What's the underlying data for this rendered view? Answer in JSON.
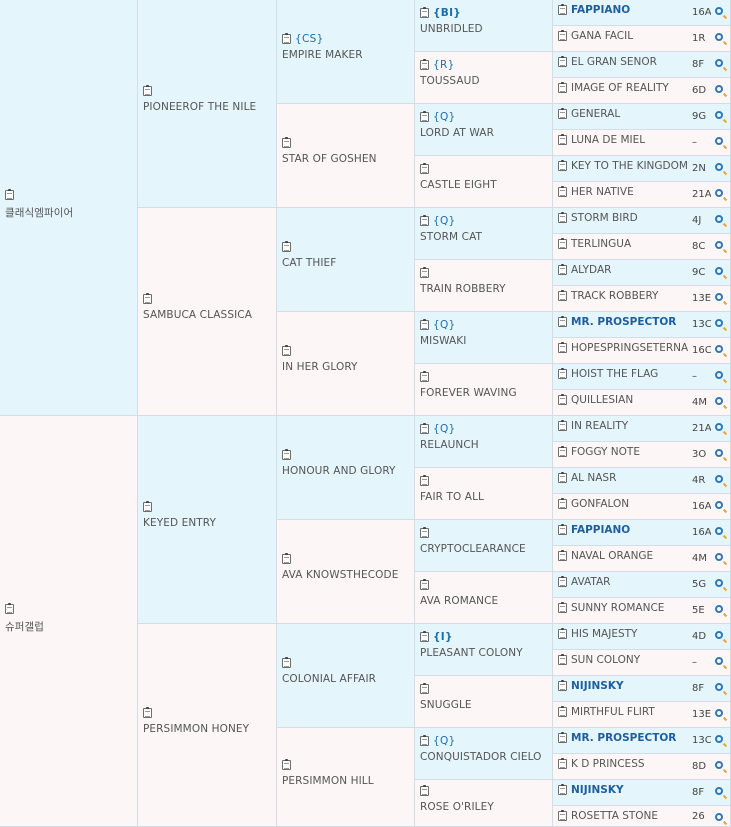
{
  "pedigree": {
    "gen1": [
      {
        "name": "클래식엠파이어",
        "sex": "m"
      },
      {
        "name": "슈퍼갤럽",
        "sex": "f"
      }
    ],
    "gen2": [
      {
        "name": "PIONEEROF THE NILE",
        "sex": "m"
      },
      {
        "name": "SAMBUCA CLASSICA",
        "sex": "f"
      },
      {
        "name": "KEYED ENTRY",
        "sex": "m"
      },
      {
        "name": "PERSIMMON HONEY",
        "sex": "f"
      }
    ],
    "gen3": [
      {
        "name": "EMPIRE MAKER",
        "sex": "m",
        "dosage": "{CS}"
      },
      {
        "name": "STAR OF GOSHEN",
        "sex": "f"
      },
      {
        "name": "CAT THIEF",
        "sex": "m"
      },
      {
        "name": "IN HER GLORY",
        "sex": "f"
      },
      {
        "name": "HONOUR AND GLORY",
        "sex": "m"
      },
      {
        "name": "AVA KNOWSTHECODE",
        "sex": "f"
      },
      {
        "name": "COLONIAL AFFAIR",
        "sex": "m"
      },
      {
        "name": "PERSIMMON HILL",
        "sex": "f"
      }
    ],
    "gen4": [
      {
        "name": "UNBRIDLED",
        "sex": "m",
        "dosage": "{BI}",
        "dosage_bold": true
      },
      {
        "name": "TOUSSAUD",
        "sex": "f",
        "dosage": "{R}"
      },
      {
        "name": "LORD AT WAR",
        "sex": "m",
        "dosage": "{Q}"
      },
      {
        "name": "CASTLE EIGHT",
        "sex": "f"
      },
      {
        "name": "STORM CAT",
        "sex": "m",
        "dosage": "{Q}"
      },
      {
        "name": "TRAIN ROBBERY",
        "sex": "f"
      },
      {
        "name": "MISWAKI",
        "sex": "m",
        "dosage": "{Q}"
      },
      {
        "name": "FOREVER WAVING",
        "sex": "f"
      },
      {
        "name": "RELAUNCH",
        "sex": "m",
        "dosage": "{Q}"
      },
      {
        "name": "FAIR TO ALL",
        "sex": "f"
      },
      {
        "name": "CRYPTOCLEARANCE",
        "sex": "m"
      },
      {
        "name": "AVA ROMANCE",
        "sex": "f"
      },
      {
        "name": "PLEASANT COLONY",
        "sex": "m",
        "dosage": "{I}",
        "dosage_bold": true
      },
      {
        "name": "SNUGGLE",
        "sex": "f"
      },
      {
        "name": "CONQUISTADOR CIELO",
        "sex": "m",
        "dosage": "{Q}"
      },
      {
        "name": "ROSE O'RILEY",
        "sex": "f"
      }
    ],
    "gen5": [
      {
        "name": "FAPPIANO",
        "code": "16A",
        "sex": "m",
        "bold": true
      },
      {
        "name": "GANA FACIL",
        "code": "1R",
        "sex": "f"
      },
      {
        "name": "EL GRAN SENOR",
        "code": "8F",
        "sex": "m"
      },
      {
        "name": "IMAGE OF REALITY",
        "code": "6D",
        "sex": "f"
      },
      {
        "name": "GENERAL",
        "code": "9G",
        "sex": "m"
      },
      {
        "name": "LUNA DE MIEL",
        "code": "–",
        "sex": "f"
      },
      {
        "name": "KEY TO THE KINGDOM",
        "code": "2N",
        "sex": "m"
      },
      {
        "name": "HER NATIVE",
        "code": "21A",
        "sex": "f"
      },
      {
        "name": "STORM BIRD",
        "code": "4J",
        "sex": "m"
      },
      {
        "name": "TERLINGUA",
        "code": "8C",
        "sex": "f"
      },
      {
        "name": "ALYDAR",
        "code": "9C",
        "sex": "m"
      },
      {
        "name": "TRACK ROBBERY",
        "code": "13E",
        "sex": "f"
      },
      {
        "name": "MR. PROSPECTOR",
        "code": "13C",
        "sex": "m",
        "bold": true
      },
      {
        "name": "HOPESPRINGSETERNAL",
        "code": "16C",
        "sex": "f"
      },
      {
        "name": "HOIST THE FLAG",
        "code": "–",
        "sex": "m"
      },
      {
        "name": "QUILLESIAN",
        "code": "4M",
        "sex": "f"
      },
      {
        "name": "IN REALITY",
        "code": "21A",
        "sex": "m"
      },
      {
        "name": "FOGGY NOTE",
        "code": "3O",
        "sex": "f"
      },
      {
        "name": "AL NASR",
        "code": "4R",
        "sex": "m"
      },
      {
        "name": "GONFALON",
        "code": "16A",
        "sex": "f"
      },
      {
        "name": "FAPPIANO",
        "code": "16A",
        "sex": "m",
        "bold": true
      },
      {
        "name": "NAVAL ORANGE",
        "code": "4M",
        "sex": "f"
      },
      {
        "name": "AVATAR",
        "code": "5G",
        "sex": "m"
      },
      {
        "name": "SUNNY ROMANCE",
        "code": "5E",
        "sex": "f"
      },
      {
        "name": "HIS MAJESTY",
        "code": "4D",
        "sex": "m"
      },
      {
        "name": "SUN COLONY",
        "code": "–",
        "sex": "f"
      },
      {
        "name": "NIJINSKY",
        "code": "8F",
        "sex": "m",
        "bold": true
      },
      {
        "name": "MIRTHFUL FLIRT",
        "code": "13E",
        "sex": "f"
      },
      {
        "name": "MR. PROSPECTOR",
        "code": "13C",
        "sex": "m",
        "bold": true
      },
      {
        "name": "K D PRINCESS",
        "code": "8D",
        "sex": "f"
      },
      {
        "name": "NIJINSKY",
        "code": "8F",
        "sex": "m",
        "bold": true
      },
      {
        "name": "ROSETTA STONE",
        "code": "26",
        "sex": "f"
      }
    ]
  },
  "colors": {
    "male_bg": "#e4f5fb",
    "female_bg": "#fdf6f6",
    "link": "#1d6fa8",
    "border": "#d4dde6"
  },
  "icons": {
    "horse_detail": "clipboard-icon",
    "search": "magnifier-icon"
  }
}
